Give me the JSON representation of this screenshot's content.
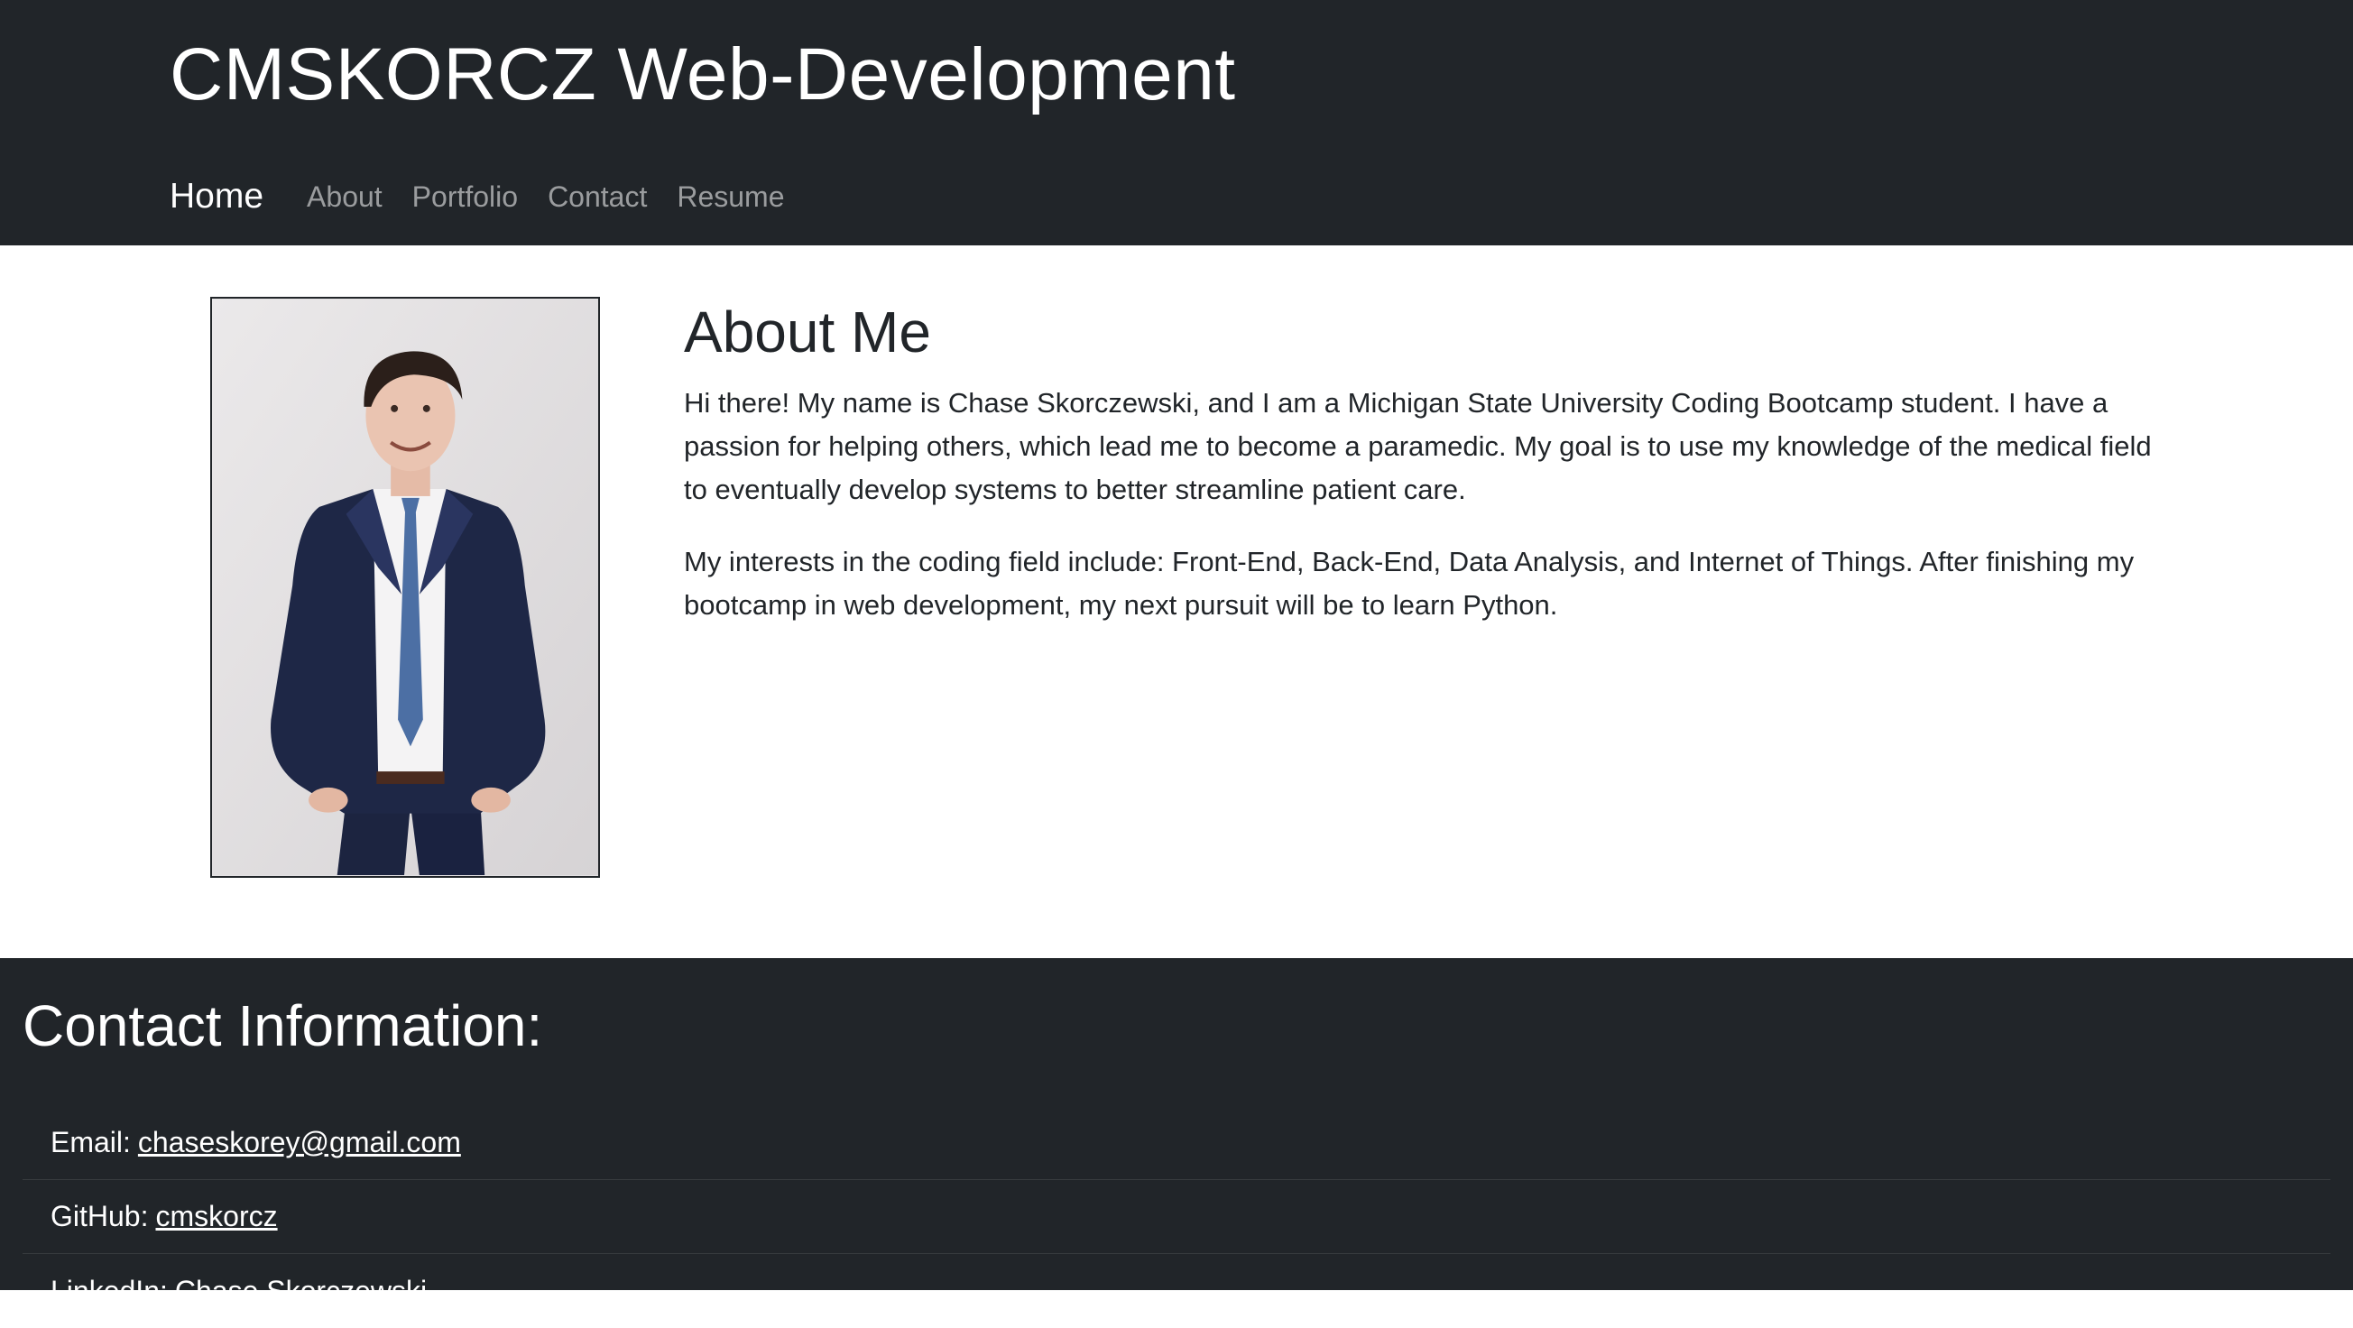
{
  "header": {
    "site_title": "CMSKORCZ Web-Development",
    "nav": [
      "Home",
      "About",
      "Portfolio",
      "Contact",
      "Resume"
    ],
    "active_nav": "Home"
  },
  "about": {
    "heading": "About Me",
    "paragraphs": [
      "Hi there! My name is Chase Skorczewski, and I am a Michigan State University Coding Bootcamp student. I have a passion for helping others, which lead me to become a paramedic. My goal is to use my knowledge of the medical field to eventually develop systems to better streamline patient care.",
      "My interests in the coding field include: Front-End, Back-End, Data Analysis, and Internet of Things. After finishing my bootcamp in web development, my next pursuit will be to learn Python."
    ],
    "portrait_alt": "Portrait photo"
  },
  "contact": {
    "heading": "Contact Information:",
    "items": [
      {
        "label": "Email:",
        "link_text": "chaseskorey@gmail.com"
      },
      {
        "label": "GitHub:",
        "link_text": "cmskorcz"
      },
      {
        "label": "LinkedIn:",
        "link_text": "Chase Skorczewski"
      }
    ]
  },
  "colors": {
    "header_bg": "#212529",
    "text_dark": "#212529",
    "nav_inactive": "rgba(255,255,255,0.55)",
    "white": "#ffffff"
  }
}
